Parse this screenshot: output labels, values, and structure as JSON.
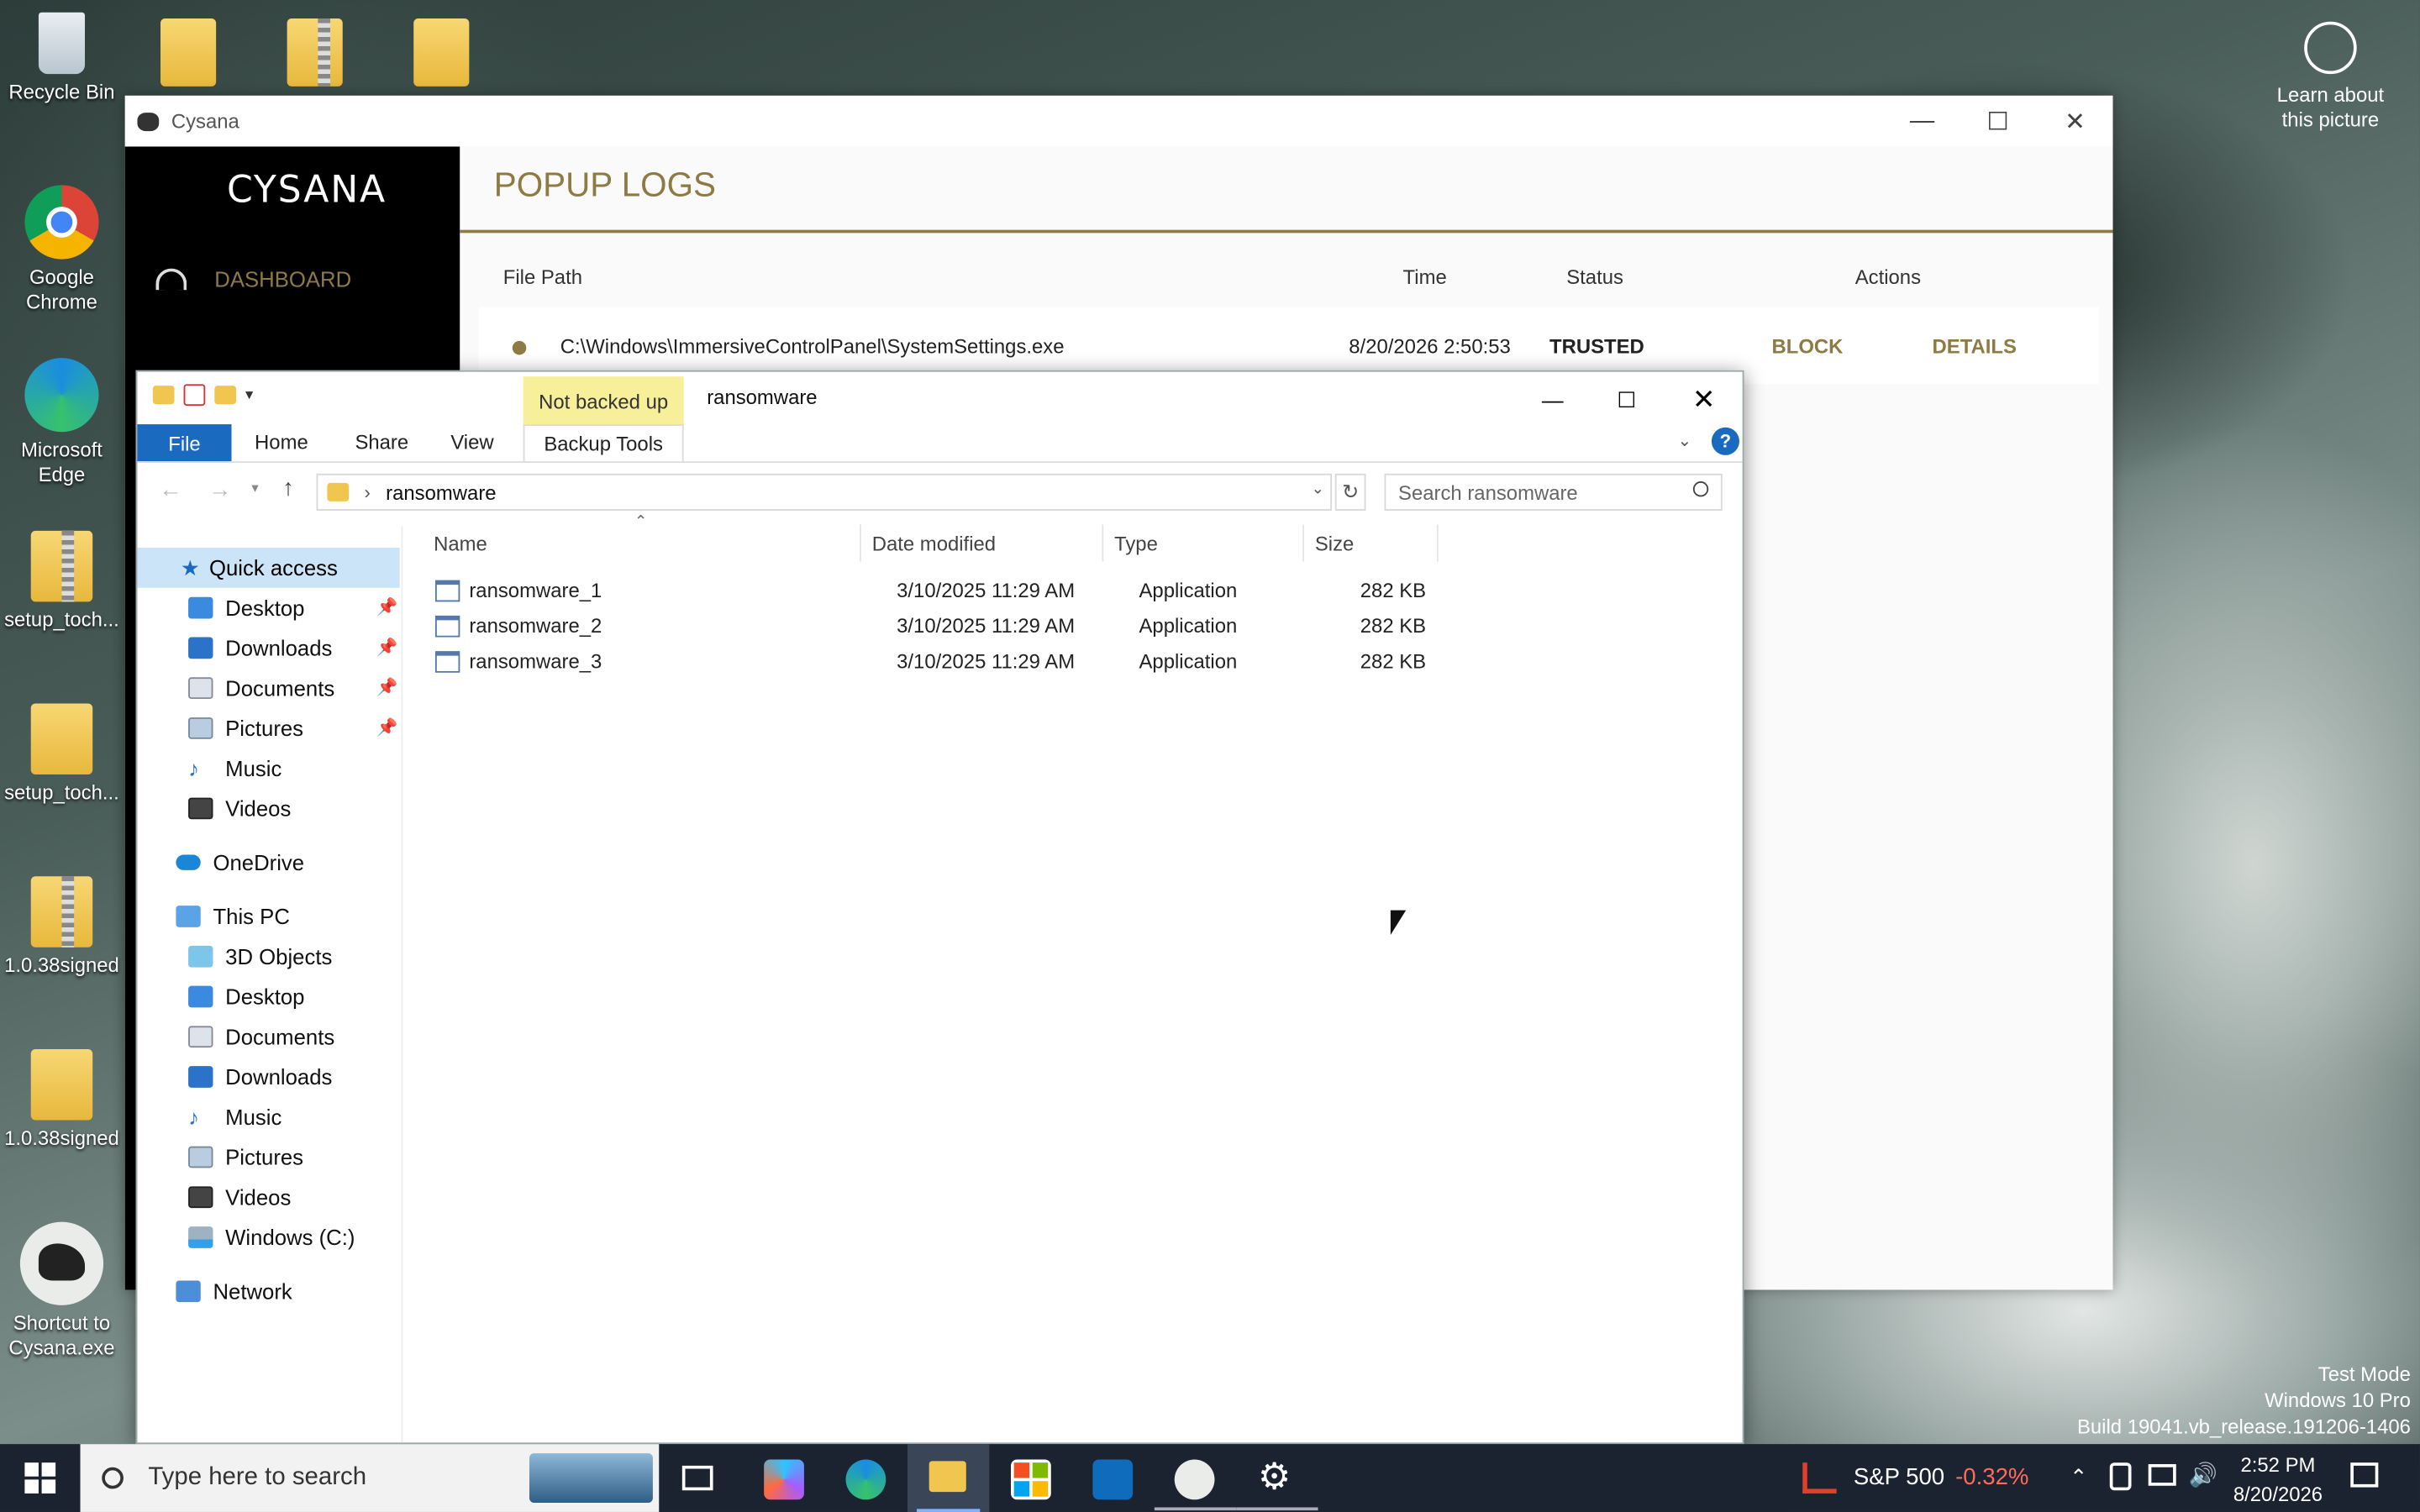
{
  "desktop": {
    "icons": [
      {
        "label": "Recycle Bin"
      },
      {
        "label": "Google Chrome"
      },
      {
        "label": "Microsoft Edge"
      },
      {
        "label": "setup_toch..."
      },
      {
        "label": "setup_toch..."
      },
      {
        "label": "1.0.38signed"
      },
      {
        "label": "1.0.38signed"
      },
      {
        "label": "Shortcut to Cysana.exe"
      }
    ],
    "learn_about": "Learn about this picture",
    "watermark": [
      "Test Mode",
      "Windows 10 Pro",
      "Build 19041.vb_release.191206-1406"
    ]
  },
  "cysana": {
    "window_title": "Cysana",
    "logo_text": "CYSANA",
    "nav": [
      {
        "label": "DASHBOARD",
        "icon": "speedometer-icon"
      }
    ],
    "page_title": "POPUP LOGS",
    "columns": {
      "path": "File Path",
      "time": "Time",
      "status": "Status",
      "actions": "Actions"
    },
    "rows": [
      {
        "path": "C:\\Windows\\ImmersiveControlPanel\\SystemSettings.exe",
        "time": "8/20/2026 2:50:53",
        "status": "TRUSTED",
        "action1": "BLOCK",
        "action2": "DETAILS"
      }
    ],
    "colors": {
      "gold": "#8e7a43",
      "sidebar": "#000000"
    }
  },
  "explorer": {
    "title": "ransomware",
    "badge": "Not backed up",
    "tabs": {
      "file": "File",
      "home": "Home",
      "share": "Share",
      "view": "View",
      "backup": "Backup Tools"
    },
    "breadcrumb": "ransomware",
    "search_placeholder": "Search ransomware",
    "nav": {
      "quick_access": "Quick access",
      "quick_items": [
        "Desktop",
        "Downloads",
        "Documents",
        "Pictures",
        "Music",
        "Videos"
      ],
      "onedrive": "OneDrive",
      "this_pc": "This PC",
      "pc_items": [
        "3D Objects",
        "Desktop",
        "Documents",
        "Downloads",
        "Music",
        "Pictures",
        "Videos",
        "Windows (C:)"
      ],
      "network": "Network"
    },
    "columns": {
      "name": "Name",
      "date": "Date modified",
      "type": "Type",
      "size": "Size"
    },
    "files": [
      {
        "name": "ransomware_1",
        "date": "3/10/2025 11:29 AM",
        "type": "Application",
        "size": "282 KB"
      },
      {
        "name": "ransomware_2",
        "date": "3/10/2025 11:29 AM",
        "type": "Application",
        "size": "282 KB"
      },
      {
        "name": "ransomware_3",
        "date": "3/10/2025 11:29 AM",
        "type": "Application",
        "size": "282 KB"
      }
    ]
  },
  "taskbar": {
    "search_placeholder": "Type here to search",
    "stock_name": "S&P 500",
    "stock_change": "-0.32%",
    "time": "2:52 PM",
    "date": "8/20/2026"
  }
}
